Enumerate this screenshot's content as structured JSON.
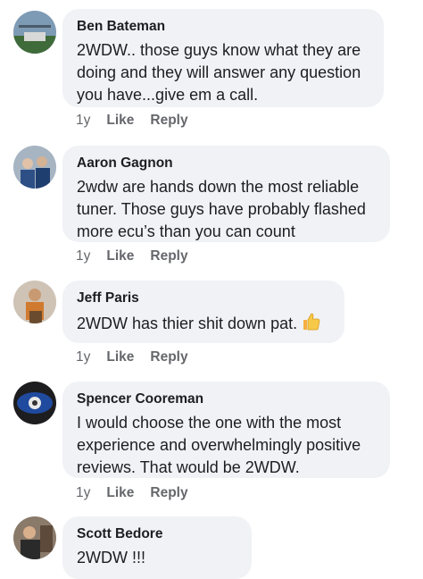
{
  "comments": [
    {
      "name": "Ben Bateman",
      "text": "2WDW.. those guys know what they are doing and they will answer any question you have...give em a call.",
      "time": "1y",
      "like": "Like",
      "reply": "Reply"
    },
    {
      "name": "Aaron Gagnon",
      "text": "2wdw are hands down the most reliable tuner. Those guys have probably flashed more ecu’s than you can count",
      "time": "1y",
      "like": "Like",
      "reply": "Reply"
    },
    {
      "name": "Jeff Paris",
      "text": "2WDW has thier shit down pat.",
      "emoji": "thumbs-up-icon",
      "time": "1y",
      "like": "Like",
      "reply": "Reply"
    },
    {
      "name": "Spencer Cooreman",
      "text": "I would choose the one with the most experience and  overwhelmingly positive reviews. That would be 2WDW.",
      "time": "1y",
      "like": "Like",
      "reply": "Reply"
    },
    {
      "name": "Scott Bedore",
      "text": "2WDW !!!"
    }
  ],
  "colors": {
    "bubble": "#f0f2f5",
    "meta": "#65676b",
    "text": "#1c1e21"
  }
}
